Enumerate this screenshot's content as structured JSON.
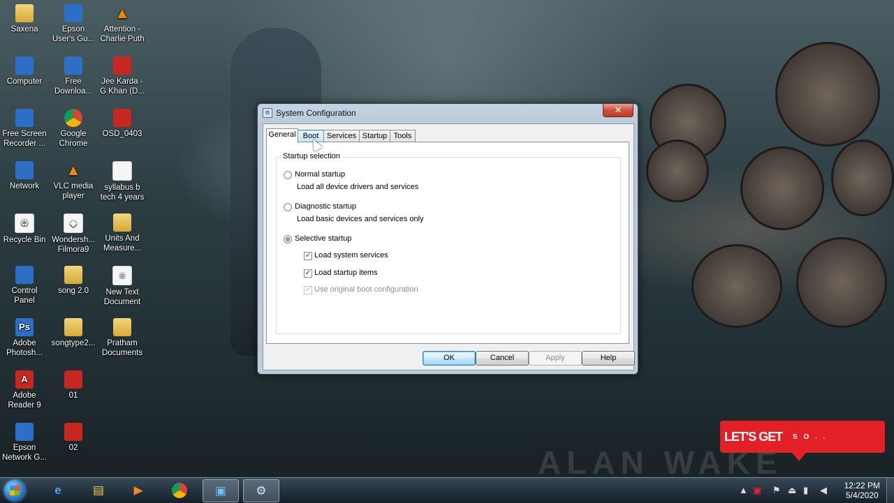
{
  "desktop": {
    "icons": [
      {
        "label": "Saxena",
        "icon": "folder-icon"
      },
      {
        "label": "Epson\nUser's Gu...",
        "icon": "epson-manual-icon"
      },
      {
        "label": "Attention -\nCharlie Puth",
        "icon": "vlc-icon"
      },
      {
        "label": "Computer",
        "icon": "computer-icon"
      },
      {
        "label": "Free\nDownloa...",
        "icon": "free-download-icon"
      },
      {
        "label": "Jee Karda -\nG Khan (D...",
        "icon": "video-thumbnail-icon"
      },
      {
        "label": "Free Screen\nRecorder ...",
        "icon": "screen-recorder-icon"
      },
      {
        "label": "Google\nChrome",
        "icon": "chrome-icon"
      },
      {
        "label": "OSD_0403",
        "icon": "image-file-icon"
      },
      {
        "label": "Network",
        "icon": "network-icon"
      },
      {
        "label": "VLC media\nplayer",
        "icon": "vlc-icon"
      },
      {
        "label": "syllabus b\ntech 4 years",
        "icon": "png-file-icon"
      },
      {
        "label": "Recycle Bin",
        "icon": "recycle-bin-icon"
      },
      {
        "label": "Wondersh...\nFilmora9",
        "icon": "filmora-icon"
      },
      {
        "label": "Units And\nMeasure...",
        "icon": "folder-icon"
      },
      {
        "label": "Control\nPanel",
        "icon": "control-panel-icon"
      },
      {
        "label": "song 2.0",
        "icon": "folder-icon"
      },
      {
        "label": "New Text\nDocument",
        "icon": "text-document-icon"
      },
      {
        "label": "Adobe\nPhotosh...",
        "icon": "photoshop-icon"
      },
      {
        "label": "songtype2...",
        "icon": "folder-icon"
      },
      {
        "label": "Pratham\nDocuments",
        "icon": "folder-icon"
      },
      {
        "label": "Adobe\nReader 9",
        "icon": "adobe-reader-icon"
      },
      {
        "label": "01",
        "icon": "image-file-icon"
      },
      {
        "label": "Epson\nNetwork G...",
        "icon": "epson-network-icon"
      },
      {
        "label": "02",
        "icon": "image-file-icon"
      }
    ],
    "watermark": "ALAN WAKE",
    "banner": {
      "big": "LET'S GET",
      "small": "S O . ."
    }
  },
  "dialog": {
    "title": "System Configuration",
    "close": "✕",
    "tabs": [
      {
        "label": "General",
        "active": true
      },
      {
        "label": "Boot",
        "active": false
      },
      {
        "label": "Services",
        "active": false
      },
      {
        "label": "Startup",
        "active": false
      },
      {
        "label": "Tools",
        "active": false
      }
    ],
    "group_title": "Startup selection",
    "options": {
      "normal": {
        "label": "Normal startup",
        "desc": "Load all device drivers and services",
        "selected": false
      },
      "diagnostic": {
        "label": "Diagnostic startup",
        "desc": "Load basic devices and services only",
        "selected": false
      },
      "selective": {
        "label": "Selective startup",
        "selected": true
      }
    },
    "checks": {
      "system_services": {
        "label": "Load system services",
        "checked": true,
        "enabled": true
      },
      "startup_items": {
        "label": "Load startup items",
        "checked": true,
        "enabled": true
      },
      "original_boot": {
        "label": "Use original boot configuration",
        "checked": true,
        "enabled": false
      }
    },
    "check_mark": "✓",
    "buttons": {
      "ok": "OK",
      "cancel": "Cancel",
      "apply": "Apply",
      "help": "Help"
    }
  },
  "taskbar": {
    "pinned": [
      "internet-explorer-icon",
      "file-explorer-icon",
      "media-player-icon",
      "chrome-icon",
      "screen-recorder-icon",
      "system-configuration-icon"
    ],
    "tray_icons": [
      "show-hidden-icon",
      "app-tray-icon",
      "action-center-flag-icon",
      "usb-icon",
      "signal-icon",
      "volume-icon"
    ],
    "time": "12:22 PM",
    "date": "5/4/2020"
  }
}
